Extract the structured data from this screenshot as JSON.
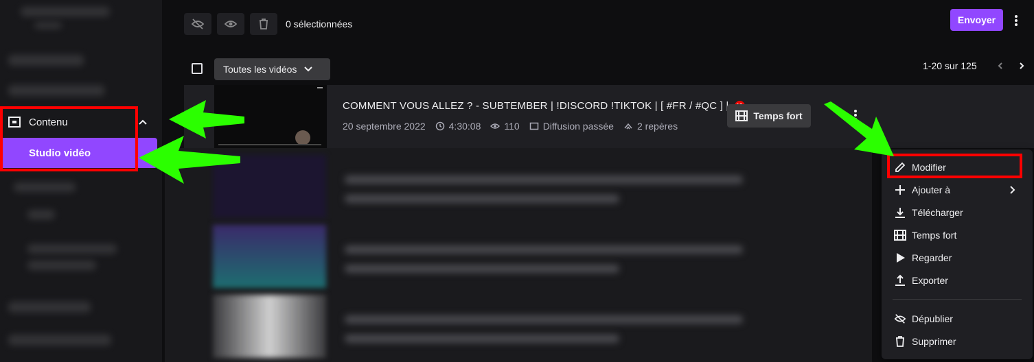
{
  "sidebar": {
    "contenu_label": "Contenu",
    "studio_label": "Studio vidéo"
  },
  "toolbar": {
    "selected_count": "0 sélectionnées",
    "send_label": "Envoyer"
  },
  "list": {
    "filter_label": "Toutes les vidéos",
    "pagination": "1-20 sur 125"
  },
  "video": {
    "title": "COMMENT VOUS ALLEZ ? - SUBTEMBER | !DISCORD !TIKTOK | [ #FR / #QC ] |",
    "rating_badge": "18",
    "date": "20 septembre 2022",
    "duration": "4:30:08",
    "views": "110",
    "type": "Diffusion passée",
    "markers": "2 repères",
    "highlight_button": "Temps fort"
  },
  "menu": {
    "items": [
      {
        "label": "Modifier",
        "icon": "pencil-icon"
      },
      {
        "label": "Ajouter à",
        "icon": "plus-icon"
      },
      {
        "label": "Télécharger",
        "icon": "download-icon"
      },
      {
        "label": "Temps fort",
        "icon": "film-icon"
      },
      {
        "label": "Regarder",
        "icon": "play-icon"
      },
      {
        "label": "Exporter",
        "icon": "upload-icon"
      },
      {
        "label": "Dépublier",
        "icon": "eye-slash-icon"
      },
      {
        "label": "Supprimer",
        "icon": "trash-icon"
      }
    ]
  },
  "colors": {
    "accent": "#9147ff",
    "annotation_red": "#ff0000",
    "annotation_arrow": "#2bff00"
  }
}
